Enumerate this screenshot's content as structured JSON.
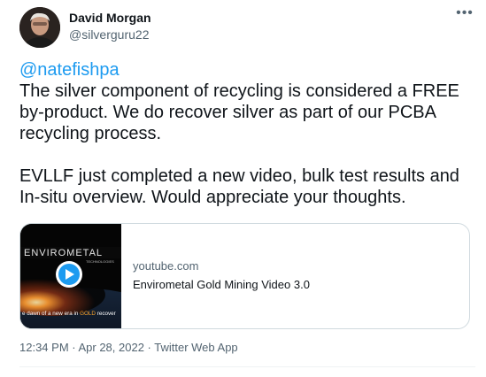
{
  "tweet": {
    "author": {
      "name": "David Morgan",
      "handle": "@silverguru22"
    },
    "mention": "@natefishpa",
    "paragraphs": [
      "The silver component of recycling is considered a FREE by-product. We do recover silver as part of our PCBA recycling process.",
      "EVLLF just completed a new video, bulk test results and In-situ overview. Would appreciate your thoughts."
    ],
    "card": {
      "brand": "ENVIROMETAL",
      "brand_sub": "TECHNOLOGIES",
      "tagline_pre": "e dawn of a new era in ",
      "tagline_gold": "GOLD",
      "tagline_post": " recover",
      "domain": "youtube.com",
      "title": "Envirometal Gold Mining Video 3.0"
    },
    "timestamp": "12:34 PM · Apr 28, 2022 · Twitter Web App"
  },
  "colors": {
    "link": "#1d9bf0",
    "secondary_text": "#536471",
    "gold": "#ffa629"
  },
  "icons": {
    "more": "more-horizontal-icon",
    "play": "play-icon"
  }
}
